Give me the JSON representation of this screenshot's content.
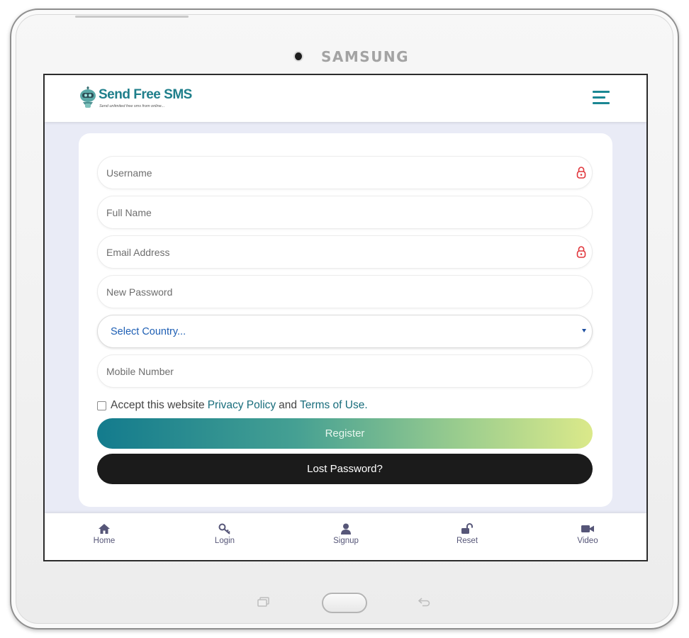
{
  "device": {
    "brand": "SAMSUNG"
  },
  "header": {
    "logo_title": "Send Free SMS",
    "logo_tagline": "Send unlimited free sms from online..."
  },
  "form": {
    "username_placeholder": "Username",
    "fullname_placeholder": "Full Name",
    "email_placeholder": "Email Address",
    "password_placeholder": "New Password",
    "country_selected": "Select Country...",
    "mobile_placeholder": "Mobile Number",
    "accept_prefix": "Accept this website",
    "privacy_link": "Privacy Policy",
    "accept_and": "and",
    "terms_link": "Terms of Use.",
    "register_label": "Register",
    "lost_password_label": "Lost Password?"
  },
  "nav": {
    "home": "Home",
    "login": "Login",
    "signup": "Signup",
    "reset": "Reset",
    "video": "Video"
  },
  "colors": {
    "accent": "#1b8793",
    "link": "#176c7b",
    "lock_icon": "#e0353b",
    "nav_icon": "#565678",
    "page_bg": "#e9ebf6",
    "register_gradient_start": "#137b8d",
    "register_gradient_end": "#dbe98a",
    "lost_button_bg": "#1b1b1b"
  }
}
